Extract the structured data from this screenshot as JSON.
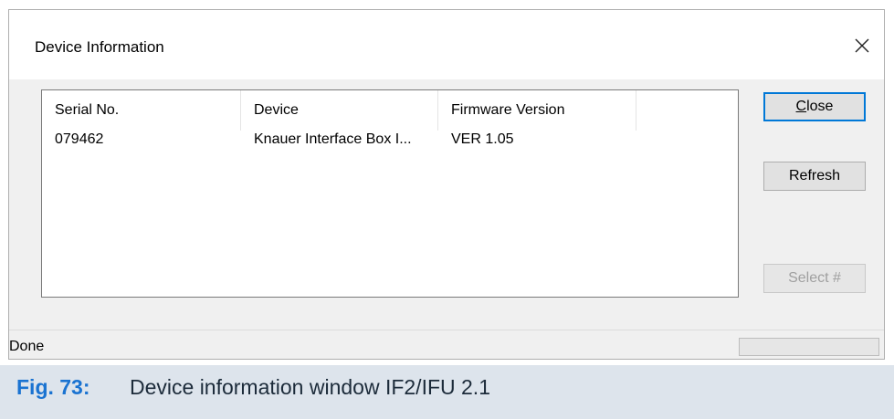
{
  "window": {
    "title": "Device Information"
  },
  "list": {
    "columns": [
      "Serial No.",
      "Device",
      "Firmware Version",
      ""
    ],
    "rows": [
      [
        "079462",
        "Knauer Interface Box I...",
        "VER 1.05",
        ""
      ]
    ]
  },
  "buttons": {
    "close_prefix": "",
    "close_mnemonic": "C",
    "close_rest": "lose",
    "refresh": "Refresh",
    "select": "Select #"
  },
  "status": {
    "text": "Done"
  },
  "caption": {
    "label": "Fig. 73:",
    "text": "Device information window IF2/IFU 2.1"
  },
  "icons": {
    "close": "close-icon"
  }
}
